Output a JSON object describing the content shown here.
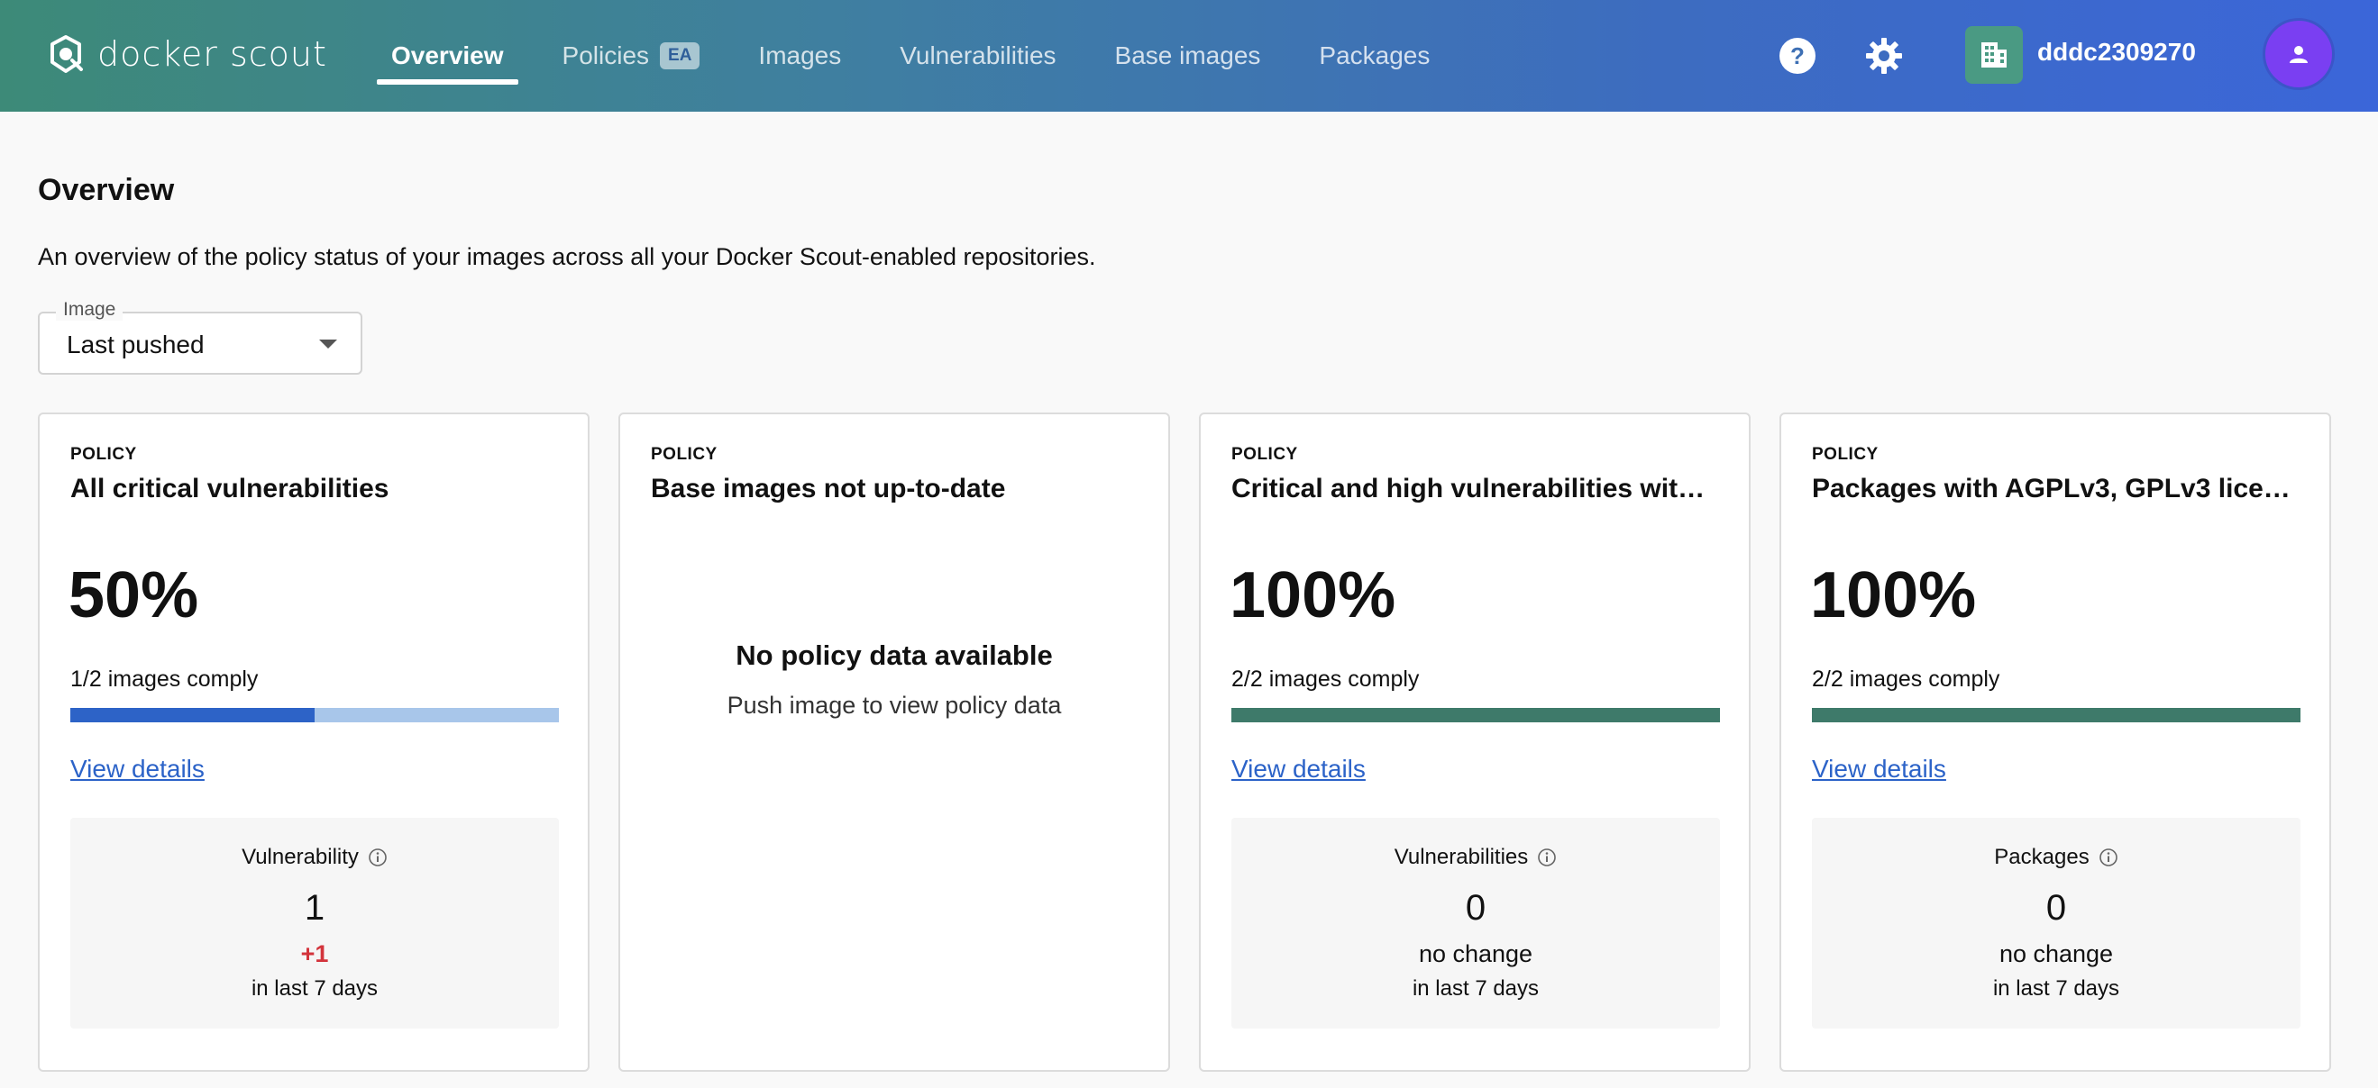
{
  "header": {
    "brand": "docker scout",
    "tabs": [
      {
        "label": "Overview",
        "active": true
      },
      {
        "label": "Policies",
        "badge": "EA"
      },
      {
        "label": "Images"
      },
      {
        "label": "Vulnerabilities"
      },
      {
        "label": "Base images"
      },
      {
        "label": "Packages"
      }
    ],
    "icons": {
      "help": "help-icon",
      "settings": "gear-icon",
      "org": "building-icon",
      "avatar": "user-icon"
    },
    "org_name": "dddc2309270",
    "colors": {
      "gradient_start": "#3d8a78",
      "gradient_end": "#3b66d9",
      "avatar": "#7a3ff2"
    }
  },
  "page": {
    "title": "Overview",
    "description": "An overview of the policy status of your images across all your Docker Scout-enabled repositories.",
    "image_select": {
      "label": "Image",
      "value": "Last pushed"
    }
  },
  "cards": [
    {
      "kicker": "POLICY",
      "title": "All critical vulnerabilities",
      "percent": "50%",
      "comply": "1/2 images comply",
      "progress": 0.5,
      "link": "View details",
      "stat": {
        "label": "Vulnerability",
        "value": "1",
        "change": "+1",
        "period": "in last 7 days"
      }
    },
    {
      "kicker": "POLICY",
      "title": "Base images not up-to-date",
      "empty_title": "No policy data available",
      "empty_sub": "Push image to view policy data"
    },
    {
      "kicker": "POLICY",
      "title": "Critical and high vulnerabilities with …",
      "percent": "100%",
      "comply": "2/2 images comply",
      "progress": 1.0,
      "link": "View details",
      "stat": {
        "label": "Vulnerabilities",
        "value": "0",
        "change": "no change",
        "period": "in last 7 days"
      }
    },
    {
      "kicker": "POLICY",
      "title": "Packages with AGPLv3, GPLv3 licen…",
      "percent": "100%",
      "comply": "2/2 images comply",
      "progress": 1.0,
      "link": "View details",
      "stat": {
        "label": "Packages",
        "value": "0",
        "change": "no change",
        "period": "in last 7 days"
      }
    }
  ],
  "colors": {
    "partial_fill": "#2d63c7",
    "partial_track": "#a8c6ea",
    "full_fill": "#3e7a6a",
    "link": "#2c63c8",
    "increase": "#d3343c"
  }
}
